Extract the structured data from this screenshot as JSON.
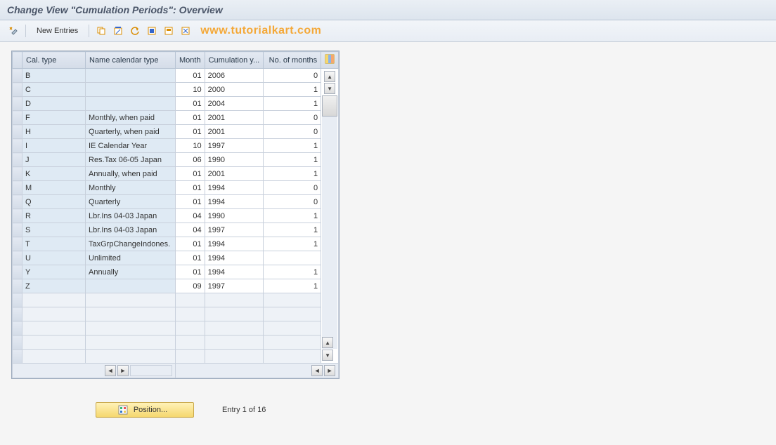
{
  "header": {
    "title": "Change View \"Cumulation Periods\": Overview"
  },
  "toolbar": {
    "new_entries_label": "New Entries",
    "watermark": "www.tutorialkart.com"
  },
  "table": {
    "headers": {
      "cal_type": "Cal. type",
      "name": "Name calendar type",
      "month": "Month",
      "cumul": "Cumulation y...",
      "months": "No. of months"
    },
    "rows": [
      {
        "cal_type": "B",
        "name": "",
        "month": "01",
        "cumul": "2006",
        "months": "0"
      },
      {
        "cal_type": "C",
        "name": "",
        "month": "10",
        "cumul": "2000",
        "months": "1"
      },
      {
        "cal_type": "D",
        "name": "",
        "month": "01",
        "cumul": "2004",
        "months": "1"
      },
      {
        "cal_type": "F",
        "name": "Monthly, when paid",
        "month": "01",
        "cumul": "2001",
        "months": "0"
      },
      {
        "cal_type": "H",
        "name": "Quarterly, when paid",
        "month": "01",
        "cumul": "2001",
        "months": "0"
      },
      {
        "cal_type": "I",
        "name": "IE Calendar Year",
        "month": "10",
        "cumul": "1997",
        "months": "1"
      },
      {
        "cal_type": "J",
        "name": "Res.Tax 06-05  Japan",
        "month": "06",
        "cumul": "1990",
        "months": "1"
      },
      {
        "cal_type": "K",
        "name": "Annually, when paid",
        "month": "01",
        "cumul": "2001",
        "months": "1"
      },
      {
        "cal_type": "M",
        "name": "Monthly",
        "month": "01",
        "cumul": "1994",
        "months": "0"
      },
      {
        "cal_type": "Q",
        "name": "Quarterly",
        "month": "01",
        "cumul": "1994",
        "months": "0"
      },
      {
        "cal_type": "R",
        "name": "Lbr.Ins 04-03  Japan",
        "month": "04",
        "cumul": "1990",
        "months": "1"
      },
      {
        "cal_type": "S",
        "name": "Lbr.Ins 04-03  Japan",
        "month": "04",
        "cumul": "1997",
        "months": "1"
      },
      {
        "cal_type": "T",
        "name": "TaxGrpChangeIndones.",
        "month": "01",
        "cumul": "1994",
        "months": "1"
      },
      {
        "cal_type": "U",
        "name": "Unlimited",
        "month": "01",
        "cumul": "1994",
        "months": ""
      },
      {
        "cal_type": "Y",
        "name": "Annually",
        "month": "01",
        "cumul": "1994",
        "months": "1"
      },
      {
        "cal_type": "Z",
        "name": "",
        "month": "09",
        "cumul": "1997",
        "months": "1"
      }
    ],
    "empty_rows": 5
  },
  "footer": {
    "position_label": "Position...",
    "entry_text": "Entry 1 of 16"
  }
}
